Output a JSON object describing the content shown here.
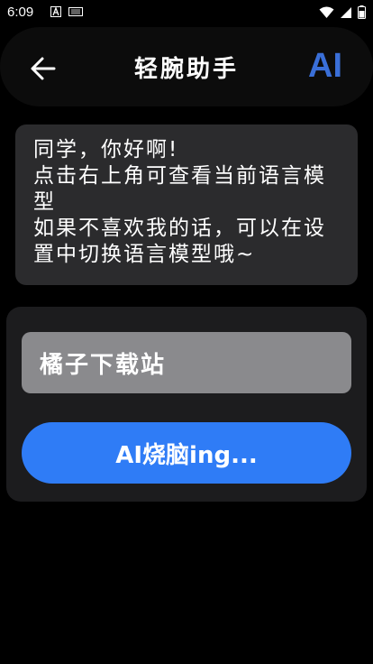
{
  "status_bar": {
    "time": "6:09",
    "left_icons": [
      "notification-a-icon",
      "notification-box-icon"
    ],
    "right_icons": [
      "wifi-icon",
      "signal-icon",
      "battery-icon"
    ]
  },
  "header": {
    "title": "轻腕助手",
    "ai_label": "AI",
    "back_icon": "arrow-left-icon"
  },
  "message": {
    "text": "同学，你好啊!\n点击右上角可查看当前语言模型\n如果不喜欢我的话，可以在设置中切换语言模型哦~"
  },
  "input": {
    "value": "橘子下载站"
  },
  "submit_button": {
    "label": "AI烧脑ing..."
  },
  "colors": {
    "background": "#000000",
    "card": "#2b2b2d",
    "panel": "#1c1c1e",
    "input": "#8a8a8d",
    "accent": "#2f7cf6",
    "ai_label": "#3a6fd8"
  }
}
